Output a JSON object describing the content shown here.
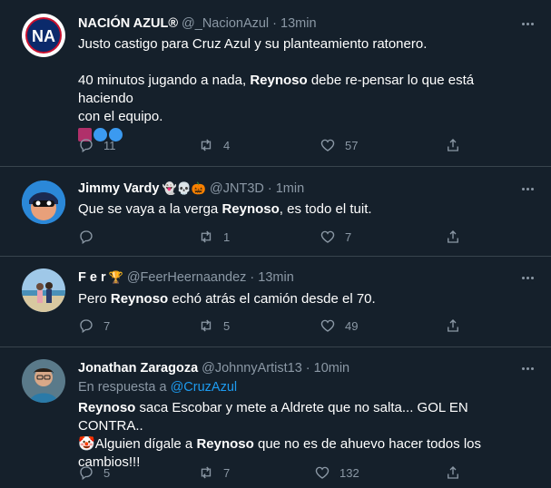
{
  "tweets": [
    {
      "name": "NACIÓN AZUL®",
      "handle": "@_NacionAzul",
      "time": "13min",
      "avatar_text": "NA",
      "lines": [
        "Justo castigo para Cruz Azul y su planteamiento ratonero.",
        "",
        "40 minutos jugando a nada, ",
        "Reynoso",
        " debe re-pensar lo que está haciendo",
        "con el equipo."
      ],
      "replies": "11",
      "retweets": "4",
      "likes": "57"
    },
    {
      "name": "Jimmy Vardy",
      "name_emojis": "👻💀🎃",
      "handle": "@JNT3D",
      "time": "1min",
      "text_pre": "Que se vaya a la verga ",
      "text_bold": "Reynoso",
      "text_post": ", es todo el tuit.",
      "replies": "",
      "retweets": "1",
      "likes": "7"
    },
    {
      "name": "F e r",
      "name_emojis": "🏆",
      "handle": "@FeerHeernaandez",
      "time": "13min",
      "text_pre": "Pero ",
      "text_bold": "Reynoso",
      "text_post": " echó atrás el camión desde el 70.",
      "replies": "7",
      "retweets": "5",
      "likes": "49"
    },
    {
      "name": "Jonathan Zaragoza",
      "handle": "@JohnnyArtist13",
      "time": "10min",
      "reply_prefix": "En respuesta a ",
      "reply_target": "@CruzAzul",
      "line1_bold": "Reynoso",
      "line1_post": " saca Escobar y mete a Aldrete que no salta... GOL EN CONTRA..",
      "line2_emoji": "🤡",
      "line2_pre": "Alguien dígale a ",
      "line2_bold": "Reynoso",
      "line2_post": " que no es de ahuevo hacer todos los",
      "line3": "cambios!!!",
      "replies": "5",
      "retweets": "7",
      "likes": "132"
    }
  ],
  "colors": {
    "background": "#15202b",
    "secondary_text": "#8b98a5",
    "link": "#1d9bf0",
    "border": "#38444d"
  },
  "icons": {
    "reply": "reply-icon",
    "retweet": "retweet-icon",
    "like": "heart-icon",
    "share": "share-icon",
    "more": "more-icon"
  }
}
